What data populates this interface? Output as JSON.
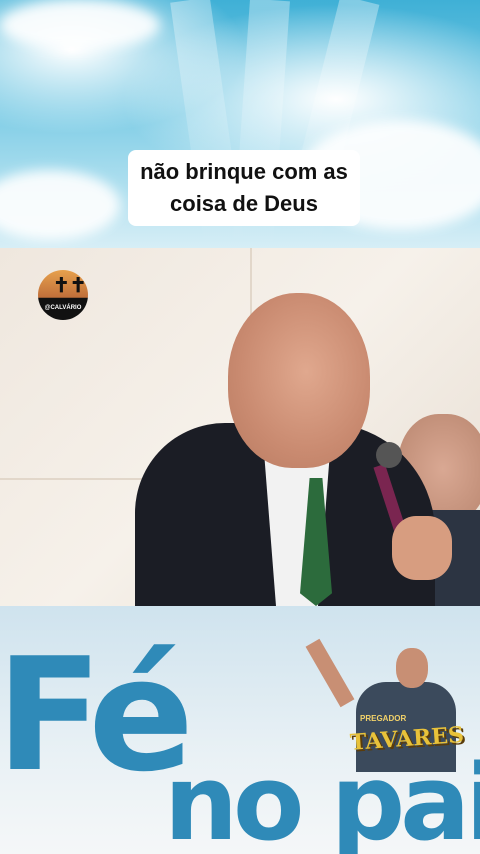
{
  "caption": {
    "line1": "não brinque com as",
    "line2": "coisa de Deus"
  },
  "video": {
    "channel_logo_text": "@CALVÁRIO",
    "logo_icon": "crosses-icon"
  },
  "banner": {
    "big_text": "Fé",
    "sub_text": "no pai",
    "brand_small": "PREGADOR",
    "brand_name": "TAVARES"
  }
}
